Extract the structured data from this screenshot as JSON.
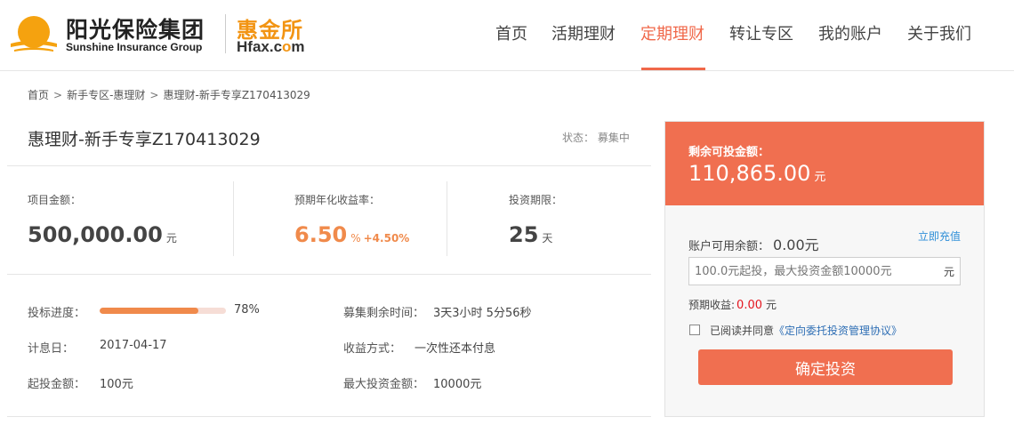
{
  "header": {
    "logo_cn": "阳光保险集团",
    "logo_en": "Sunshine Insurance Group",
    "hfax_cn": "惠金所",
    "hfax_en_pre": "Hfax.c",
    "hfax_en_o": "o",
    "hfax_en_post": "m",
    "nav": [
      "首页",
      "活期理财",
      "定期理财",
      "转让专区",
      "我的账户",
      "关于我们"
    ],
    "active_nav": "定期理财",
    "accent": "#f0684a"
  },
  "breadcrumb": [
    "首页",
    "新手专区-惠理财",
    "惠理财-新手专享Z170413029"
  ],
  "breadcrumb_sep": ">",
  "product": {
    "title": "惠理财-新手专享Z170413029",
    "status_label": "状态：",
    "status_value": "募集中",
    "amount_label": "项目金额：",
    "amount_value": "500,000.00",
    "amount_unit": "元",
    "rate_label": "预期年化收益率：",
    "rate_value": "6.50",
    "rate_unit": "%",
    "rate_bonus": "+4.50%",
    "term_label": "投资期限：",
    "term_value": "25",
    "term_unit": "天"
  },
  "details": {
    "progress_label": "投标进度：",
    "progress_fraction": 0.78,
    "progress_text": "78%",
    "remain_label": "募集剩余时间：",
    "remain_value": "3天3小时 5分56秒",
    "date_label": "计息日：",
    "date_value": "2017-04-17",
    "method_label": "收益方式：",
    "method_value": "一次性还本付息",
    "min_label": "起投金额：",
    "min_value": "100元",
    "max_label": "最大投资金额：",
    "max_value": "10000元"
  },
  "invest": {
    "remaining_label": "剩余可投金额：",
    "remaining_value": "110,865.00",
    "remaining_unit": "元",
    "balance_label": "账户可用余额：",
    "balance_value": "0.00元",
    "recharge_link": "立即充值",
    "input_placeholder": "100.0元起投，最大投资金额10000元",
    "input_unit": "元",
    "expected_label": "预期收益:",
    "expected_value": "0.00",
    "expected_unit": "元",
    "agree_text": "已阅读并同意",
    "agree_link": "《定向委托投资管理协议》",
    "confirm_label": "确定投资"
  }
}
